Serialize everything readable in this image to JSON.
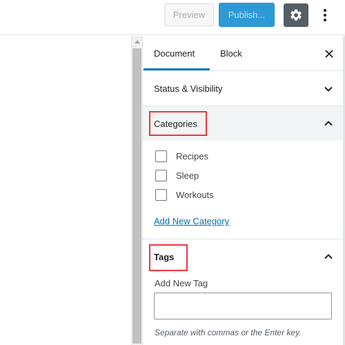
{
  "topbar": {
    "preview_label": "Preview",
    "publish_label": "Publish...",
    "settings_icon": "gear-icon",
    "more_icon": "vertical-ellipsis-icon"
  },
  "sidebar": {
    "tabs": [
      {
        "label": "Document",
        "active": true
      },
      {
        "label": "Block",
        "active": false
      }
    ],
    "close_icon": "close-icon",
    "panels": {
      "status_visibility": {
        "title": "Status & Visibility",
        "expanded": false
      },
      "categories": {
        "title": "Categories",
        "expanded": true,
        "items": [
          {
            "label": "Recipes",
            "checked": false
          },
          {
            "label": "Sleep",
            "checked": false
          },
          {
            "label": "Workouts",
            "checked": false
          }
        ],
        "add_new_label": "Add New Category"
      },
      "tags": {
        "title": "Tags",
        "expanded": true,
        "input_label": "Add New Tag",
        "input_value": "",
        "help_text": "Separate with commas or the Enter key."
      }
    }
  },
  "colors": {
    "accent": "#007cba",
    "publish": "#2d9ad6",
    "highlight": "#e8383d",
    "settings_bg": "#555d66"
  }
}
